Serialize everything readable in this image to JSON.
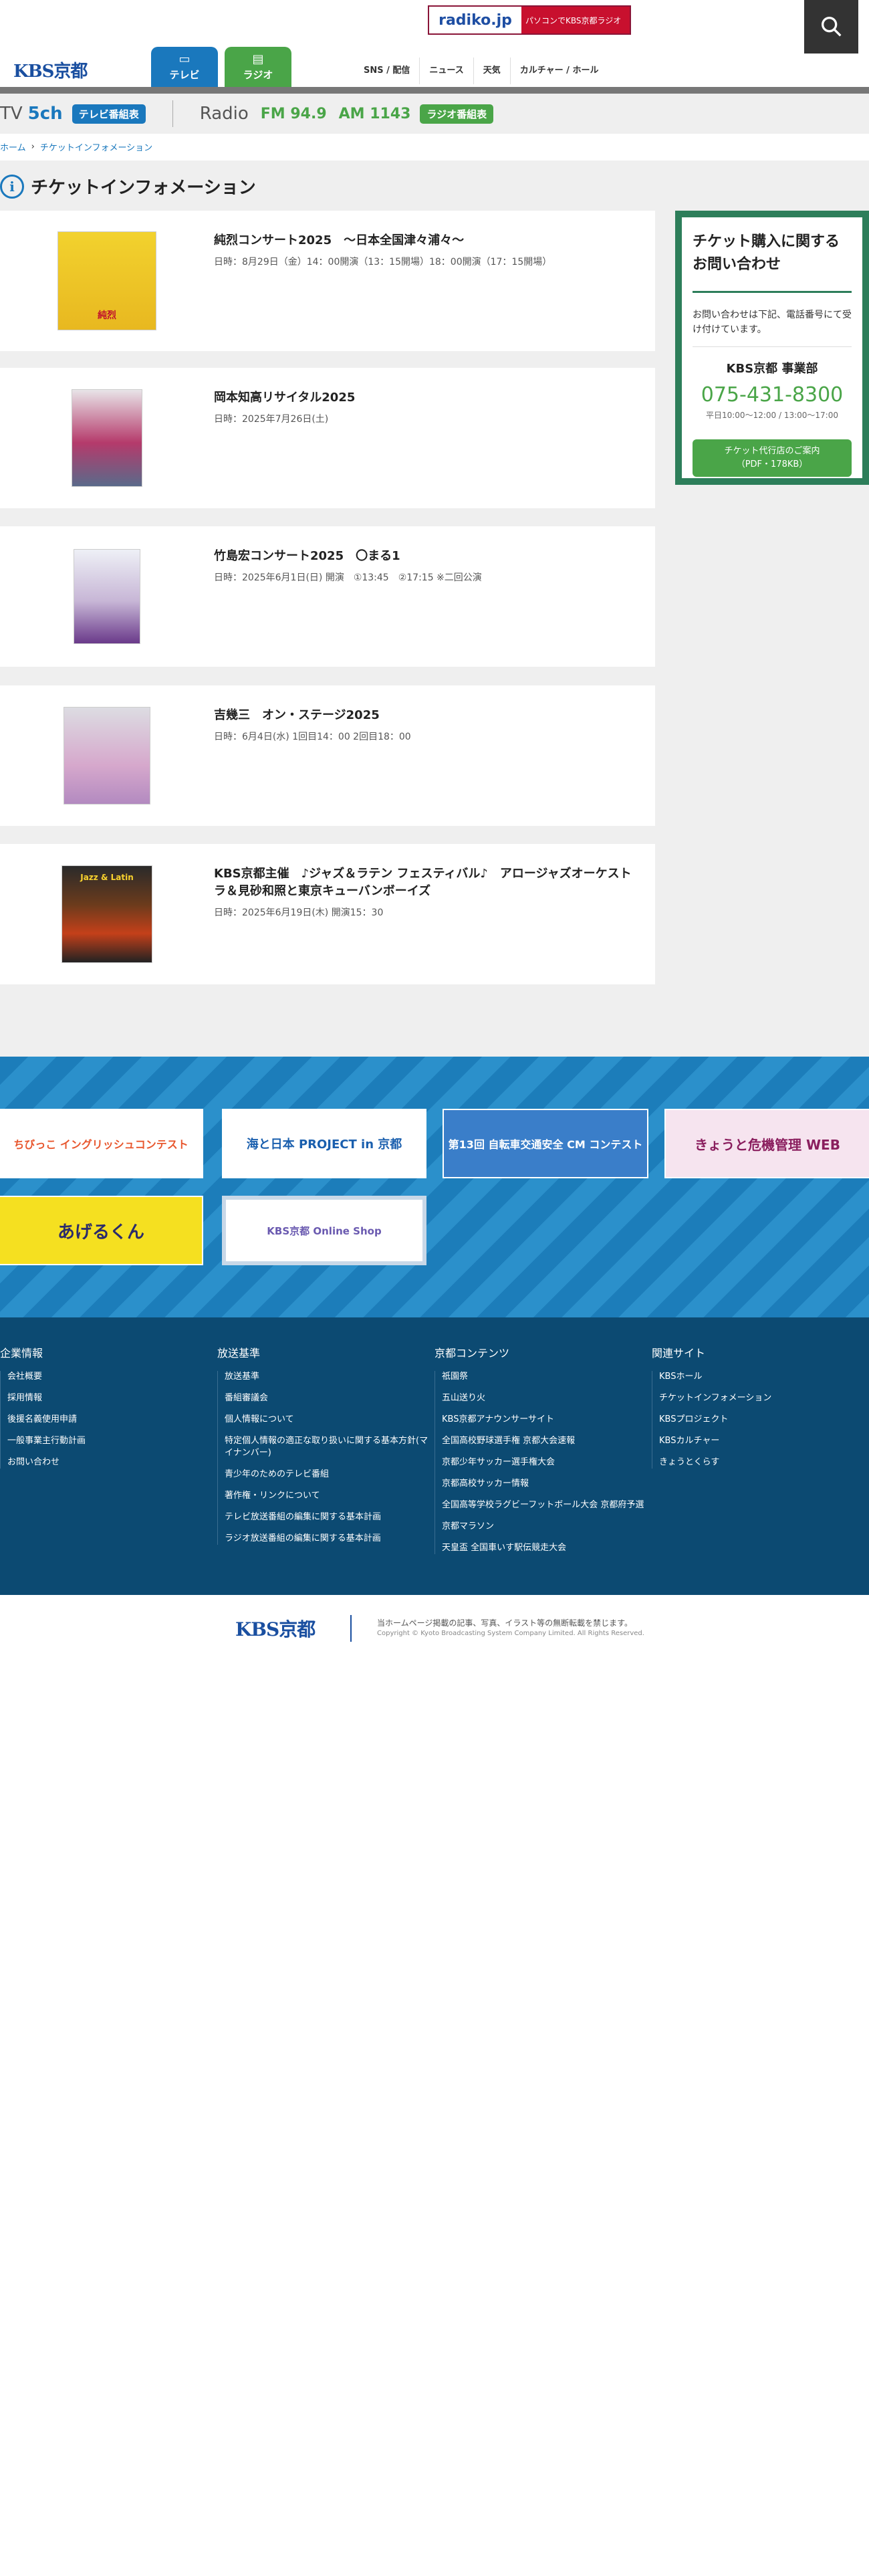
{
  "header": {
    "radiko": {
      "logo": "radiko.jp",
      "text": "パソコンでKBS京都ラジオ"
    },
    "logo": "KBS京都",
    "tabs": [
      {
        "label": "テレビ",
        "icon": "tv-icon"
      },
      {
        "label": "ラジオ",
        "icon": "radio-icon"
      }
    ],
    "nav": [
      "SNS / 配信",
      "ニュース",
      "天気",
      "カルチャー / ホール"
    ]
  },
  "channel_bar": {
    "tv_label": "TV",
    "tv_ch": "5ch",
    "tv_button": "テレビ番組表",
    "radio_label": "Radio",
    "fm": "FM 94.9",
    "am": "AM 1143",
    "radio_button": "ラジオ番組表"
  },
  "breadcrumb": {
    "home": "ホーム",
    "current": "チケットインフォメーション"
  },
  "page_title": "チケットインフォメーション",
  "events": [
    {
      "title": "純烈コンサート2025　～日本全国津々浦々～",
      "date": "日時：8月29日（金）14：00開演（13：15開場）18：00開演（17：15開場）"
    },
    {
      "title": "岡本知高リサイタル2025",
      "date": "日時：2025年7月26日(土)"
    },
    {
      "title": "竹島宏コンサート2025　〇まる1",
      "date": "日時：2025年6月1日(日) 開演　①13:45　②17:15 ※二回公演"
    },
    {
      "title": "吉幾三　オン・ステージ2025",
      "date": "日時：6月4日(水) 1回目14：00 2回目18：00"
    },
    {
      "title": "KBS京都主催　♪ジャズ＆ラテン フェスティバル♪　アロージャズオーケストラ＆見砂和照と東京キューバンボーイズ",
      "date": "日時：2025年6月19日(木) 開演15：30"
    }
  ],
  "sidebar": {
    "heading": "チケット購入に関するお問い合わせ",
    "text": "お問い合わせは下記、電話番号にて受け付けています。",
    "org": "KBS京都 事業部",
    "tel": "075-431-8300",
    "hours": "平日10:00〜12:00 / 13:00〜17:00",
    "button": "チケット代行店のご案内\n（PDF・178KB）"
  },
  "banners": [
    {
      "label": "ちびっこ イングリッシュコンテスト"
    },
    {
      "label": "海と日本 PROJECT in 京都"
    },
    {
      "label": "第13回 自転車交通安全 CM コンテスト"
    },
    {
      "label": "きょうと危機管理 WEB"
    },
    {
      "label": "あげるくん"
    },
    {
      "label": "KBS京都 Online Shop"
    }
  ],
  "footer": {
    "columns": [
      {
        "heading": "企業情報",
        "items": [
          "会社概要",
          "採用情報",
          "後援名義使用申請",
          "一般事業主行動計画",
          "お問い合わせ"
        ]
      },
      {
        "heading": "放送基準",
        "items": [
          "放送基準",
          "番組審議会",
          "個人情報について",
          "特定個人情報の適正な取り扱いに関する基本方針(マイナンバー)",
          "青少年のためのテレビ番組",
          "著作権・リンクについて",
          "テレビ放送番組の編集に関する基本計画",
          "ラジオ放送番組の編集に関する基本計画"
        ]
      },
      {
        "heading": "京都コンテンツ",
        "items": [
          "祇園祭",
          "五山送り火",
          "KBS京都アナウンサーサイト",
          "全国高校野球選手権 京都大会速報",
          "京都少年サッカー選手権大会",
          "京都高校サッカー情報",
          "全国高等学校ラグビーフットボール大会 京都府予選",
          "京都マラソン",
          "天皇盃 全国車いす駅伝競走大会"
        ]
      },
      {
        "heading": "関連サイト",
        "items": [
          "KBSホール",
          "チケットインフォメーション",
          "KBSプロジェクト",
          "KBSカルチャー",
          "きょうとくらす"
        ]
      }
    ],
    "logo": "KBS京都",
    "note": "当ホームページ掲載の記事、写真、イラスト等の無断転載を禁じます。",
    "copyright": "Copyright © Kyoto Broadcasting System Company Limited. All Rights Reserved."
  }
}
